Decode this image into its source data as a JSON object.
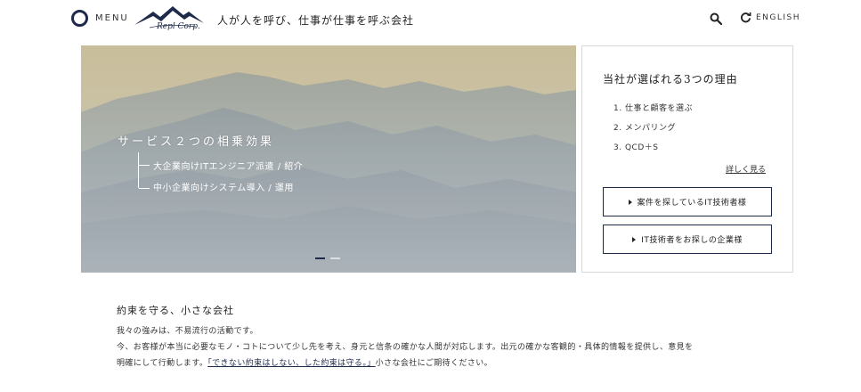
{
  "header": {
    "menu_label": "MENU",
    "logo_text": "Repl Corp.",
    "tagline": "人が人を呼び、仕事が仕事を呼ぶ会社",
    "lang_label": "ENGLISH",
    "icons": {
      "menu": "circle-menu-icon",
      "search": "search-icon",
      "lang": "refresh-icon"
    }
  },
  "hero": {
    "title": "サービス２つの相乗効果",
    "items": [
      "大企業向けITエンジニア派遣 / 紹介",
      "中小企業向けシステム導入 / 運用"
    ],
    "slide_count": 2,
    "active_slide": 1
  },
  "panel": {
    "title": "当社が選ばれる3つの理由",
    "reasons": [
      "1. 仕事と顧客を選ぶ",
      "2. メンパリング",
      "3. QCD＋S"
    ],
    "more_link": "詳しく見る",
    "buttons": [
      "案件を探しているIT技術者様",
      "IT技術者をお探しの企業様"
    ]
  },
  "intro": {
    "title": "約束を守る、小さな会社",
    "line1": "我々の強みは、不易流行の活動です。",
    "line2": "今、お客様が本当に必要なモノ・コトについて少し先を考え、身元と信条の確かな人間が対応します。出元の確かな客観的・具体的情報を提供し、意見を",
    "line3_pre": "明確にして行動します。",
    "line3_quote": "「できない約束はしない、した約束は守る。」",
    "line3_post": "小さな会社にご期待ください。"
  },
  "colors": {
    "navy": "#1e2a4a",
    "border": "#d8d8d8"
  }
}
